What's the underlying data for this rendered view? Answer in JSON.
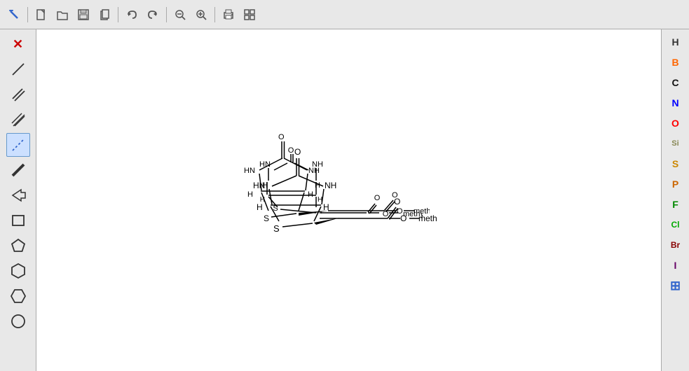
{
  "toolbar": {
    "tools": [
      {
        "name": "select-tool",
        "icon": "✏️",
        "label": "Select"
      },
      {
        "name": "new-doc",
        "icon": "□",
        "label": "New"
      },
      {
        "name": "open-doc",
        "icon": "📂",
        "label": "Open"
      },
      {
        "name": "save-doc",
        "icon": "💾",
        "label": "Save"
      },
      {
        "name": "copy-doc",
        "icon": "⧉",
        "label": "Copy"
      },
      {
        "name": "undo",
        "icon": "↩",
        "label": "Undo"
      },
      {
        "name": "redo",
        "icon": "↪",
        "label": "Redo"
      },
      {
        "name": "zoom-out",
        "icon": "🔍−",
        "label": "Zoom Out"
      },
      {
        "name": "zoom-in",
        "icon": "🔍+",
        "label": "Zoom In"
      },
      {
        "name": "print",
        "icon": "🖨",
        "label": "Print"
      },
      {
        "name": "settings",
        "icon": "⊞",
        "label": "Settings"
      }
    ]
  },
  "leftPanel": {
    "tools": [
      {
        "name": "delete-tool",
        "icon": "✕",
        "label": "Delete",
        "class": "red-x"
      },
      {
        "name": "line-tool",
        "icon": "/",
        "label": "Single Bond"
      },
      {
        "name": "dbl-line-tool",
        "icon": "//",
        "label": "Double Bond"
      },
      {
        "name": "triple-line-tool",
        "icon": "///",
        "label": "Triple Bond"
      },
      {
        "name": "dashed-tool",
        "icon": "⋯",
        "label": "Dashed Bond",
        "active": true
      },
      {
        "name": "bold-tool",
        "icon": "╱",
        "label": "Bold Bond"
      },
      {
        "name": "arrow-tool",
        "icon": "▷",
        "label": "Arrow"
      },
      {
        "name": "rect-tool",
        "icon": "□",
        "label": "Rectangle"
      },
      {
        "name": "pentagon-tool",
        "icon": "⬠",
        "label": "Pentagon"
      },
      {
        "name": "hexagon-tool",
        "icon": "⬡",
        "label": "Hexagon"
      },
      {
        "name": "hexagon2-tool",
        "icon": "⬡",
        "label": "Hexagon 2"
      },
      {
        "name": "circle-tool",
        "icon": "○",
        "label": "Circle"
      }
    ]
  },
  "rightPanel": {
    "elements": [
      {
        "symbol": "H",
        "class": "elem-H"
      },
      {
        "symbol": "B",
        "class": "elem-B"
      },
      {
        "symbol": "C",
        "class": "elem-C"
      },
      {
        "symbol": "N",
        "class": "elem-N"
      },
      {
        "symbol": "O",
        "class": "elem-O"
      },
      {
        "symbol": "Si",
        "class": "elem-Si"
      },
      {
        "symbol": "S",
        "class": "elem-S"
      },
      {
        "symbol": "P",
        "class": "elem-P"
      },
      {
        "symbol": "F",
        "class": "elem-F"
      },
      {
        "symbol": "Cl",
        "class": "elem-Cl"
      },
      {
        "symbol": "Br",
        "class": "elem-Br"
      },
      {
        "symbol": "I",
        "class": "elem-I"
      }
    ]
  }
}
